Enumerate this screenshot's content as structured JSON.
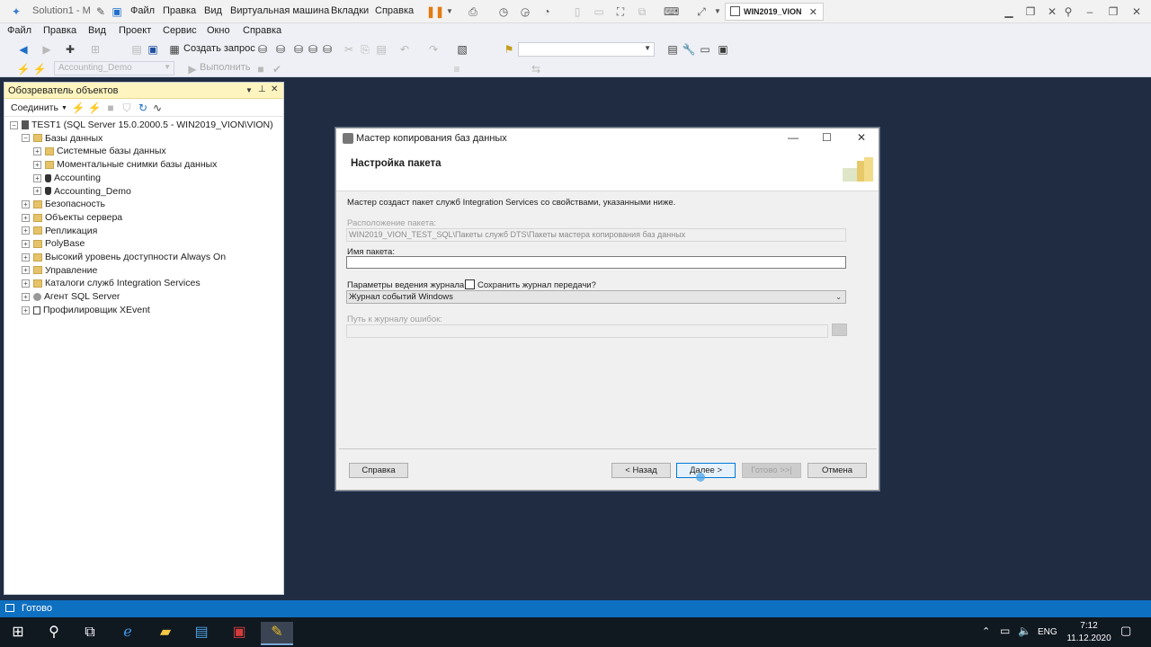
{
  "vm": {
    "solution_tab": "Solution1 - M",
    "menu": [
      "Файл",
      "Правка",
      "Вид",
      "Виртуальная машина",
      "Вкладки",
      "Справка"
    ],
    "vm_tab": "WIN2019_VION"
  },
  "ssms": {
    "menu": [
      "Файл",
      "Правка",
      "Вид",
      "Проект",
      "Сервис",
      "Окно",
      "Справка"
    ],
    "new_query": "Создать запрос",
    "db_combo": "Accounting_Demo",
    "execute": "Выполнить"
  },
  "object_explorer": {
    "title": "Обозреватель объектов",
    "connect": "Соединить",
    "tree": [
      {
        "label": "TEST1 (SQL Server 15.0.2000.5 - WIN2019_VION\\VION)",
        "level": 0,
        "icon": "server-icon",
        "expander": "−"
      },
      {
        "label": "Базы данных",
        "level": 1,
        "icon": "folder-icon",
        "expander": "−"
      },
      {
        "label": "Системные базы данных",
        "level": 2,
        "icon": "folder-icon",
        "expander": "+"
      },
      {
        "label": "Моментальные снимки базы данных",
        "level": 2,
        "icon": "folder-icon",
        "expander": "+"
      },
      {
        "label": "Accounting",
        "level": 2,
        "icon": "database-icon",
        "expander": "+"
      },
      {
        "label": "Accounting_Demo",
        "level": 2,
        "icon": "database-icon",
        "expander": "+"
      },
      {
        "label": "Безопасность",
        "level": 1,
        "icon": "folder-icon",
        "expander": "+"
      },
      {
        "label": "Объекты сервера",
        "level": 1,
        "icon": "folder-icon",
        "expander": "+"
      },
      {
        "label": "Репликация",
        "level": 1,
        "icon": "folder-icon",
        "expander": "+"
      },
      {
        "label": "PolyBase",
        "level": 1,
        "icon": "folder-icon",
        "expander": "+"
      },
      {
        "label": "Высокий уровень доступности Always On",
        "level": 1,
        "icon": "folder-icon",
        "expander": "+"
      },
      {
        "label": "Управление",
        "level": 1,
        "icon": "folder-icon",
        "expander": "+"
      },
      {
        "label": "Каталоги служб Integration Services",
        "level": 1,
        "icon": "folder-icon",
        "expander": "+"
      },
      {
        "label": "Агент SQL Server",
        "level": 1,
        "icon": "agent-icon",
        "expander": "+"
      },
      {
        "label": "Профилировщик XEvent",
        "level": 1,
        "icon": "profiler-icon",
        "expander": "+"
      }
    ]
  },
  "dialog": {
    "title": "Мастер копирования баз данных",
    "heading": "Настройка пакета",
    "description": "Мастер создаст пакет служб Integration Services со свойствами, указанными ниже.",
    "location_label": "Расположение пакета:",
    "location_value": "WIN2019_VION_TEST_SQL\\Пакеты служб DTS\\Пакеты мастера копирования баз данных",
    "name_label": "Имя пакета:",
    "name_value": "",
    "logging_label": "Параметры ведения журнала:",
    "save_log_label": "Сохранить журнал передачи?",
    "logging_value": "Журнал событий Windows",
    "error_log_label": "Путь к журналу ошибок:",
    "buttons": {
      "help": "Справка",
      "back": "< Назад",
      "next": "Далее >",
      "finish": "Готово >>|",
      "cancel": "Отмена"
    }
  },
  "status": {
    "text": "Готово"
  },
  "taskbar": {
    "lang": "ENG",
    "time": "7:12",
    "date": "11.12.2020"
  }
}
